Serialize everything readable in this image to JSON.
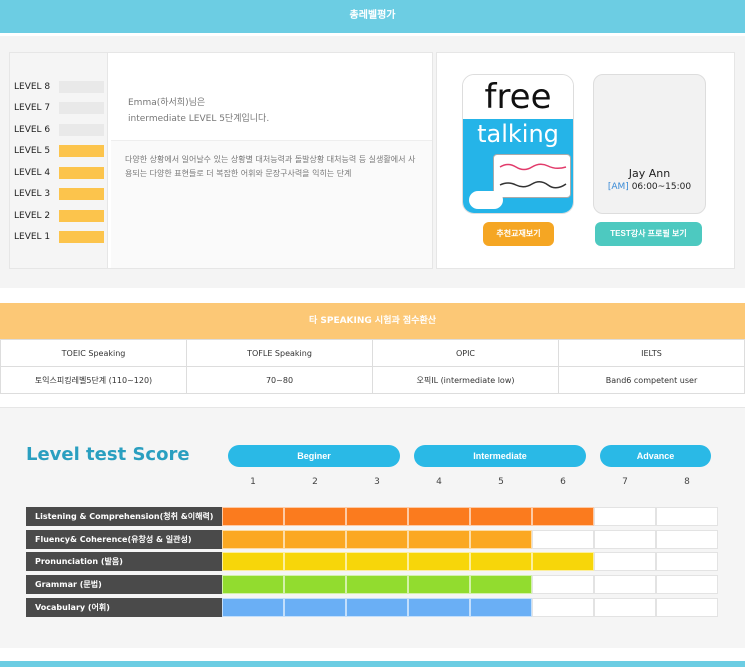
{
  "header": {
    "title": "총레벨평가"
  },
  "levels": [
    {
      "label": "LEVEL 8",
      "on": false
    },
    {
      "label": "LEVEL 7",
      "on": false
    },
    {
      "label": "LEVEL 6",
      "on": false
    },
    {
      "label": "LEVEL 5",
      "on": true
    },
    {
      "label": "LEVEL 4",
      "on": true
    },
    {
      "label": "LEVEL 3",
      "on": true
    },
    {
      "label": "LEVEL 2",
      "on": true
    },
    {
      "label": "LEVEL 1",
      "on": true
    }
  ],
  "result": {
    "name_line": "Emma(하서희)님은",
    "level_line": "intermediate LEVEL 5단계입니다.",
    "description": "다양한 상황에서 일어날수 있는 상황별 대처능력과 돌발상황 대처능력 등 실생활에서 사용되는 다양한 표현들로 더 복잡한 어휘와 문장구사력을 익히는 단계"
  },
  "book": {
    "word_top": "free",
    "word_bottom": "talking",
    "button": "추천교재보기"
  },
  "teacher": {
    "name": "Jay Ann",
    "time_prefix": "[AM]",
    "time": "06:00~15:00",
    "button": "TEST강사 프로필 보기"
  },
  "conversion": {
    "title": "타 SPEAKING 시험과 점수환산",
    "headers": [
      "TOEIC Speaking",
      "TOFLE Speaking",
      "OPIC",
      "IELTS"
    ],
    "values": [
      "토익스피킹레벨5단계 (110~120)",
      "70~80",
      "오픽IL (intermediate low)",
      "Band6 competent user"
    ]
  },
  "score": {
    "title": "Level test Score",
    "bands": [
      "Beginer",
      "Intermediate",
      "Advance"
    ],
    "levels": [
      "1",
      "2",
      "3",
      "4",
      "5",
      "6",
      "7",
      "8"
    ],
    "max": 8,
    "rows": [
      {
        "label": "Listening & Comprehension(청취 &이해력)",
        "value": 6,
        "color": "#fb7b1e"
      },
      {
        "label": "Fluency& Coherence(유창성 & 일관성)",
        "value": 5,
        "color": "#fba822"
      },
      {
        "label": "Pronunciation (발음)",
        "value": 6,
        "color": "#f7d60a"
      },
      {
        "label": "Grammar (문법)",
        "value": 5,
        "color": "#92dc2f"
      },
      {
        "label": "Vocabulary (어휘)",
        "value": 5,
        "color": "#6aaff5"
      }
    ]
  }
}
